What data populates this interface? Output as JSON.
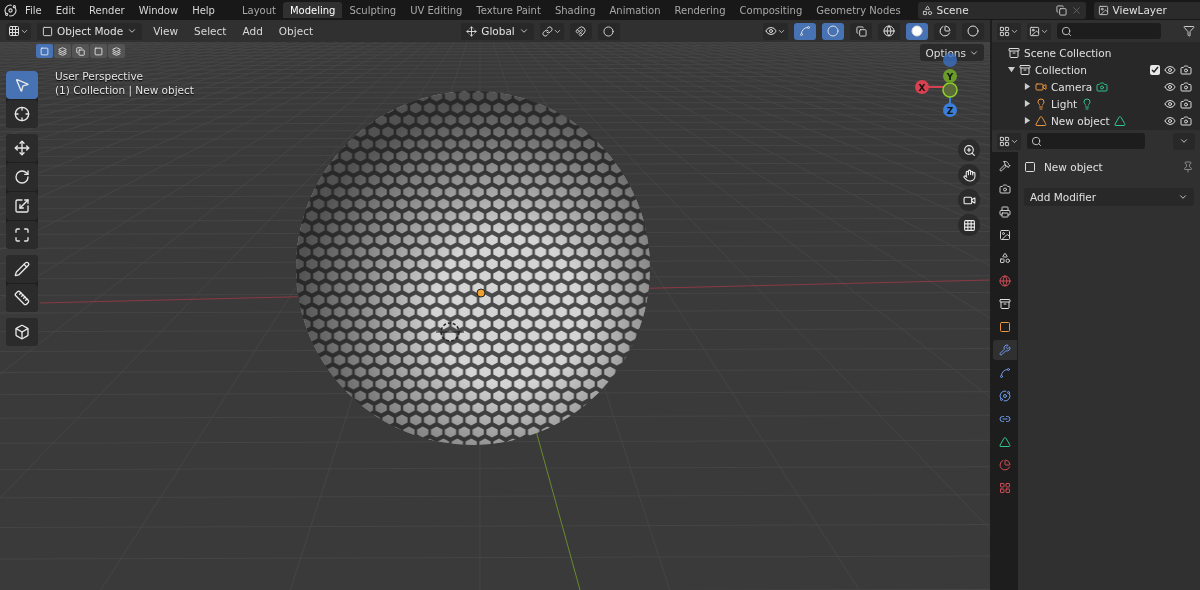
{
  "menu": [
    "File",
    "Edit",
    "Render",
    "Window",
    "Help"
  ],
  "workspaces": [
    {
      "label": "Layout",
      "selected": false
    },
    {
      "label": "Modeling",
      "selected": true
    },
    {
      "label": "Sculpting",
      "selected": false
    },
    {
      "label": "UV Editing",
      "selected": false
    },
    {
      "label": "Texture Paint",
      "selected": false
    },
    {
      "label": "Shading",
      "selected": false
    },
    {
      "label": "Animation",
      "selected": false
    },
    {
      "label": "Rendering",
      "selected": false
    },
    {
      "label": "Compositing",
      "selected": false
    },
    {
      "label": "Geometry Nodes",
      "selected": false
    }
  ],
  "scene": "Scene",
  "view_layer": "ViewLayer",
  "viewport": {
    "mode": "Object Mode",
    "menus": [
      "View",
      "Select",
      "Add",
      "Object"
    ],
    "orientation": "Global",
    "options": "Options",
    "info": [
      "User Perspective",
      "(1) Collection | New object"
    ],
    "axes": [
      {
        "label": "X"
      },
      {
        "label": "Y"
      },
      {
        "label": "Z"
      }
    ],
    "tool_groups": [
      [
        {
          "kind": "select",
          "selected": true
        },
        {
          "kind": "cursor",
          "selected": false
        }
      ],
      [
        {
          "kind": "move",
          "selected": false
        },
        {
          "kind": "rotate",
          "selected": false
        },
        {
          "kind": "scale",
          "selected": false
        },
        {
          "kind": "transform",
          "selected": false
        }
      ],
      [
        {
          "kind": "annotate",
          "selected": false
        },
        {
          "kind": "measure",
          "selected": false
        }
      ],
      [
        {
          "kind": "add_cube",
          "selected": false
        }
      ]
    ]
  },
  "outliner": {
    "root": "Scene Collection",
    "items": [
      {
        "name": "Collection",
        "kind": "collection",
        "expanded": true,
        "checked": true,
        "children": [
          {
            "name": "Camera",
            "kind": "camera",
            "expanded": false
          },
          {
            "name": "Light",
            "kind": "light",
            "expanded": false
          },
          {
            "name": "New object",
            "kind": "mesh",
            "expanded": false
          }
        ]
      }
    ]
  },
  "properties": {
    "object": "New object",
    "add_modifier": "Add Modifier",
    "tabs": [
      {
        "kind": "tool",
        "selected": false
      },
      {
        "kind": "render",
        "selected": false
      },
      {
        "kind": "output",
        "selected": false
      },
      {
        "kind": "view_layer",
        "selected": false
      },
      {
        "kind": "scene",
        "selected": false
      },
      {
        "kind": "world",
        "selected": false
      },
      {
        "kind": "collection",
        "selected": false
      },
      {
        "kind": "object",
        "selected": false
      },
      {
        "kind": "modifiers",
        "selected": true
      },
      {
        "kind": "particles",
        "selected": false
      },
      {
        "kind": "physics",
        "selected": false
      },
      {
        "kind": "constraints",
        "selected": false
      },
      {
        "kind": "data",
        "selected": false
      },
      {
        "kind": "material",
        "selected": false
      },
      {
        "kind": "texture",
        "selected": false
      }
    ]
  }
}
